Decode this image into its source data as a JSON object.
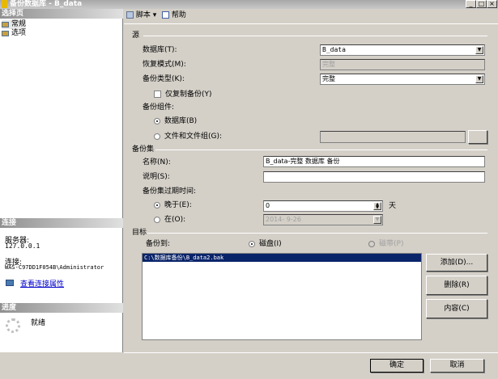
{
  "window": {
    "title": "备份数据库 - B_data"
  },
  "left": {
    "select_page_header": "选择页",
    "pages": [
      {
        "label": "常规"
      },
      {
        "label": "选项"
      }
    ],
    "connection_header": "连接",
    "server_label": "服务器:",
    "server_value": "127.0.0.1",
    "connection_label": "连接:",
    "connection_value": "WAS-C97DD1F054B\\Administrator",
    "view_link": "查看连接属性",
    "progress_header": "进度",
    "progress_status": "就绪"
  },
  "toolbar": {
    "script": "脚本",
    "help": "帮助"
  },
  "source": {
    "title": "源",
    "database_label": "数据库(T):",
    "database_value": "B_data",
    "recovery_label": "恢复模式(M):",
    "recovery_value": "完整",
    "backup_type_label": "备份类型(K):",
    "backup_type_value": "完整",
    "copy_only_label": "仅复制备份(Y)",
    "copy_only_checked": false,
    "component_label": "备份组件:",
    "component_database": "数据库(B)",
    "component_files": "文件和文件组(G):",
    "component_selected": "数据库"
  },
  "backup_set": {
    "title": "备份集",
    "name_label": "名称(N):",
    "name_value": "B_data-完整 数据库 备份",
    "description_label": "说明(S):",
    "description_value": "",
    "expire_label": "备份集过期时间:",
    "after_label": "晚于(E):",
    "after_value": "0",
    "after_unit": "天",
    "on_label": "在(O):",
    "on_value": "2014- 9-26",
    "expire_selected": "晚于"
  },
  "destination": {
    "title": "目标",
    "backup_to_label": "备份到:",
    "disk_label": "磁盘(I)",
    "tape_label": "磁带(P)",
    "selected": "磁盘",
    "files": [
      "C:\\数据库备份\\B_data2.bak"
    ],
    "add": "添加(D)...",
    "remove": "删除(R)",
    "contents": "内容(C)"
  },
  "footer": {
    "ok": "确定",
    "cancel": "取消"
  }
}
